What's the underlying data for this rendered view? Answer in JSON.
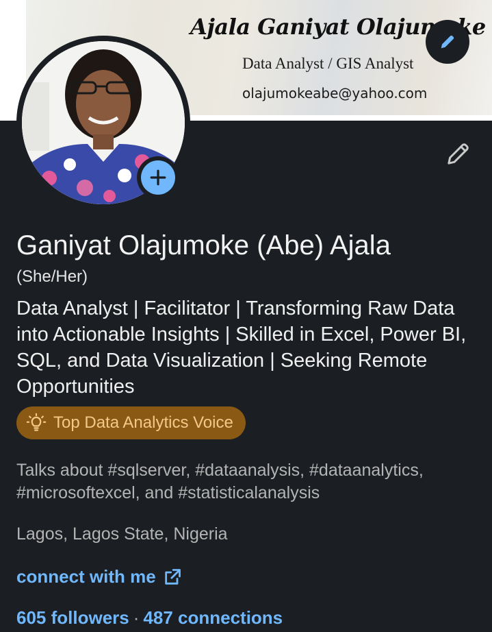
{
  "banner": {
    "name": "Ajala Ganiyat Olajumoke",
    "role": "Data Analyst / GIS Analyst",
    "email": "olajumokeabe@yahoo.com"
  },
  "profile": {
    "name": "Ganiyat Olajumoke (Abe) Ajala",
    "pronouns": "(She/Her)",
    "headline": "Data Analyst | Facilitator | Transforming Raw Data into Actionable Insights | Skilled in Excel, Power BI, SQL, and Data Visualization | Seeking Remote Opportunities",
    "badge": "Top Data Analytics Voice",
    "talks_about": "Talks about #sqlserver, #dataanalysis, #dataanalytics, #microsoftexcel, and #statisticalanalysis",
    "location": "Lagos, Lagos State, Nigeria",
    "link_label": "connect with me",
    "followers": "605 followers",
    "separator": "·",
    "connections": "487 connections"
  },
  "colors": {
    "background": "#1b1f23",
    "link": "#71b7fb",
    "badge_bg": "#8a5a14",
    "badge_text": "#f3c98a",
    "muted_text": "#b4b4b4"
  },
  "icons": {
    "banner_edit": "pencil-icon",
    "intro_edit": "pencil-icon",
    "add_photo": "plus-icon",
    "badge": "lightbulb-icon",
    "external_link": "external-link-icon"
  }
}
